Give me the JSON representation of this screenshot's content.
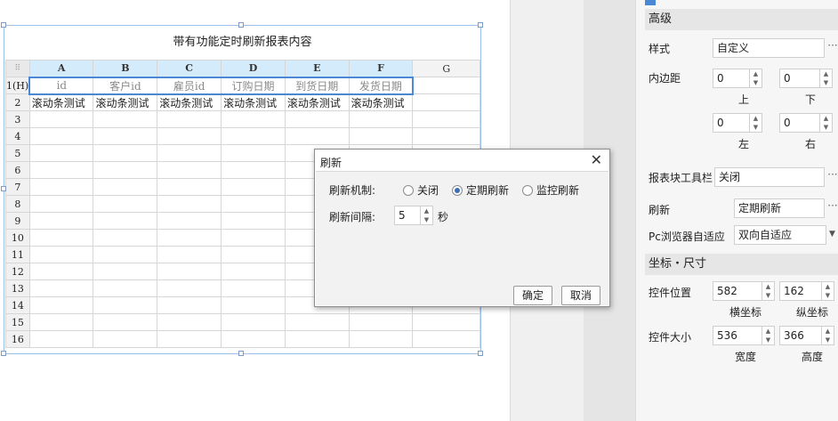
{
  "report": {
    "title": "带有功能定时刷新报表内容",
    "corner": "⠿",
    "columns": [
      "A",
      "B",
      "C",
      "D",
      "E",
      "F",
      "G"
    ],
    "header_row_label": "1(H)",
    "header_cells": [
      "id",
      "客户id",
      "雇员id",
      "订购日期",
      "到货日期",
      "发货日期"
    ],
    "data_row_label": "2",
    "data_cells": [
      "滚动条测试",
      "滚动条测试",
      "滚动条测试",
      "滚动条测试",
      "滚动条测试",
      "滚动条测试"
    ],
    "empty_rows": [
      "3",
      "4",
      "5",
      "6",
      "7",
      "8",
      "9",
      "10",
      "11",
      "12",
      "13",
      "14",
      "15",
      "16"
    ]
  },
  "dialog": {
    "title": "刷新",
    "close": "✕",
    "mechanism_label": "刷新机制:",
    "options": [
      "关闭",
      "定期刷新",
      "监控刷新"
    ],
    "selected_option": "定期刷新",
    "interval_label": "刷新间隔:",
    "interval_value": "5",
    "interval_unit": "秒",
    "ok": "确定",
    "cancel": "取消"
  },
  "panel": {
    "advanced_header": "高级",
    "style_label": "样式",
    "style_value": "自定义",
    "padding_label": "内边距",
    "padding_top": "0",
    "padding_bottom": "0",
    "padding_left": "0",
    "padding_right": "0",
    "top_label": "上",
    "bottom_label": "下",
    "left_label": "左",
    "right_label": "右",
    "toolbar_label": "报表块工具栏",
    "toolbar_value": "关闭",
    "refresh_label": "刷新",
    "refresh_value": "定期刷新",
    "adapt_label": "Pc浏览器自适应",
    "adapt_value": "双向自适应",
    "coord_header": "坐标・尺寸",
    "pos_label": "控件位置",
    "pos_x": "582",
    "pos_y": "162",
    "pos_x_label": "横坐标",
    "pos_y_label": "纵坐标",
    "size_label": "控件大小",
    "width": "536",
    "height": "366",
    "width_label": "宽度",
    "height_label": "高度",
    "ellipsis": "···"
  }
}
